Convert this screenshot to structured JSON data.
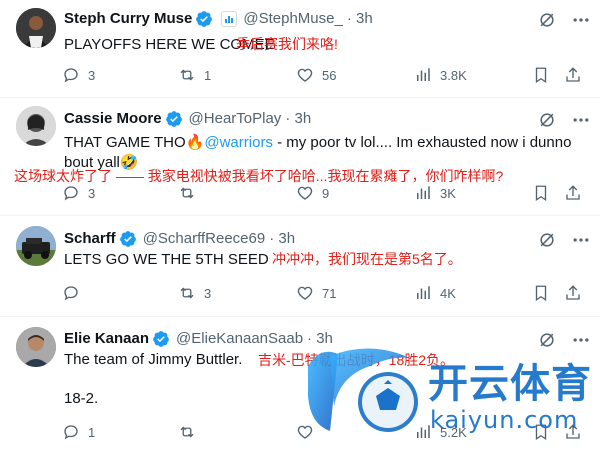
{
  "tweets": [
    {
      "name": "Steph Curry Muse",
      "handle": "@StephMuse_",
      "time": "· 3h",
      "text": "PLAYOFFS HERE WE COMEE",
      "translation": "季后赛我们来咯!",
      "replies": "3",
      "retweets": "1",
      "likes": "56",
      "views": "3.8K"
    },
    {
      "name": "Cassie Moore",
      "handle": "@HearToPlay",
      "time": "· 3h",
      "text_before": "THAT GAME THO",
      "emoji1": "🔥",
      "mention": "@warriors",
      "text_after": " - my poor tv lol.... Im exhausted now i dunno bout yall",
      "emoji2": "🤣",
      "translation": "这场球太炸了了 —— 我家电视快被我看坏了哈哈...我现在累瘫了，你们咋样啊?",
      "replies": "3",
      "retweets": "",
      "likes": "9",
      "views": "3K"
    },
    {
      "name": "Scharff",
      "handle": "@ScharffReece69",
      "time": "· 3h",
      "text": "LETS GO WE THE 5TH SEED",
      "translation": "冲冲冲，我们现在是第5名了。",
      "replies": "",
      "retweets": "3",
      "likes": "71",
      "views": "4K"
    },
    {
      "name": "Elie Kanaan",
      "handle": "@ElieKanaanSaab",
      "time": "· 3h",
      "text": "The team of Jimmy Buttler.",
      "text2": "18-2.",
      "translation": "吉米-巴特勒出战时，18胜2负。",
      "replies": "1",
      "retweets": "",
      "likes": "",
      "views": "5.2K"
    }
  ],
  "watermark": {
    "brand_cn": "开云体育",
    "brand_url": "kaiyun.com"
  },
  "colors": {
    "accent": "#1d9bf0",
    "muted": "#536471",
    "translation_red": "#e0201a",
    "watermark_blue": "#1a73c9"
  }
}
